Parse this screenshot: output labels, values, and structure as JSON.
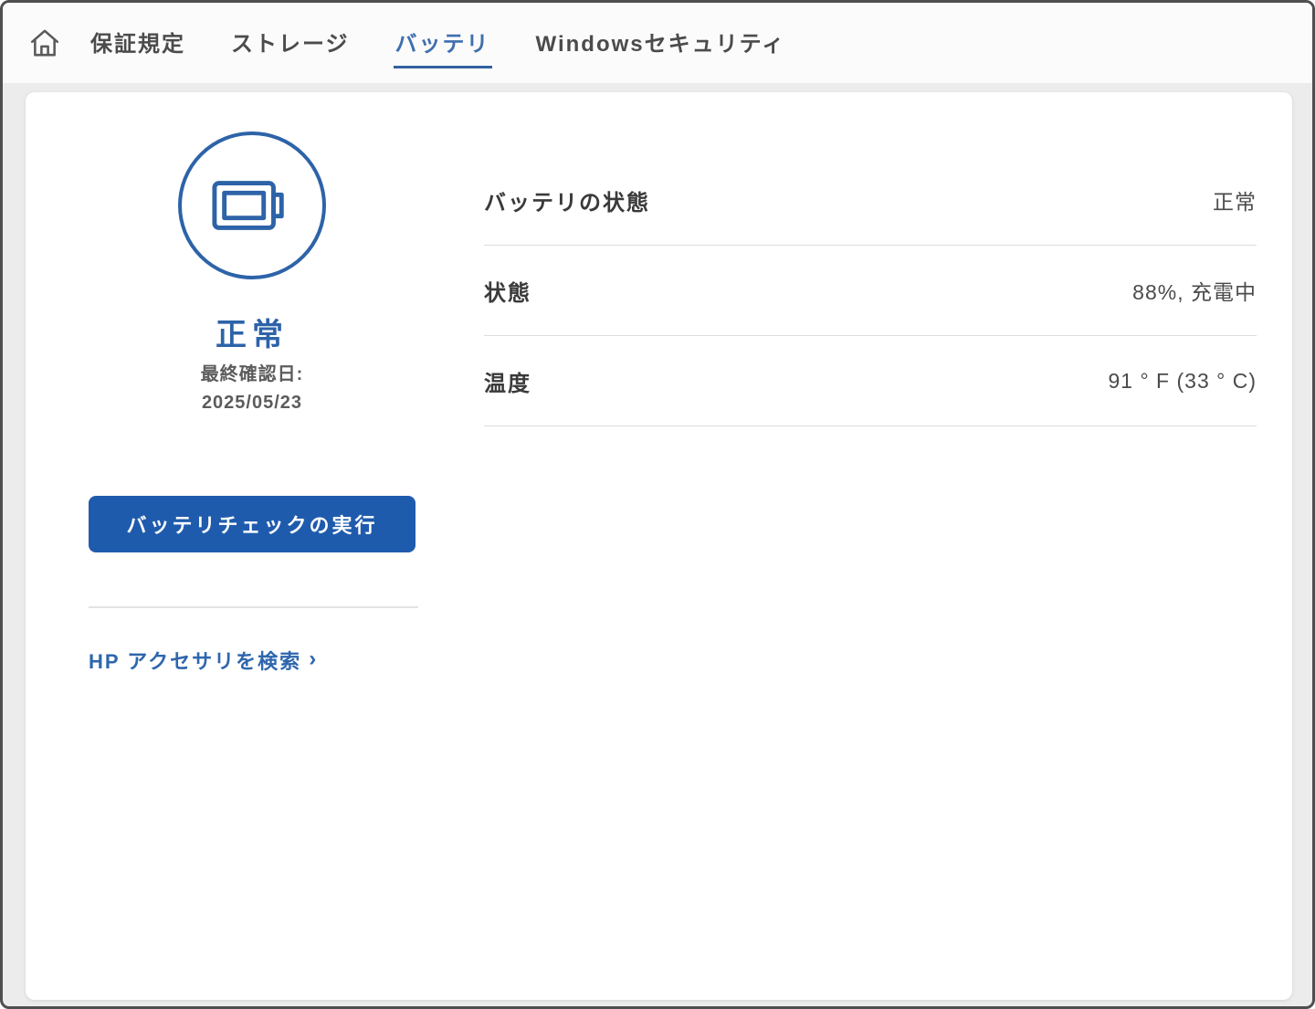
{
  "colors": {
    "accent": "#2d63a8",
    "button_bg": "#1f5bad",
    "active_tab": "#3f6fae",
    "frame_border": "#4f4f4f",
    "page_bg": "#ececec"
  },
  "nav": {
    "tabs": [
      {
        "label": "保証規定",
        "active": false
      },
      {
        "label": "ストレージ",
        "active": false
      },
      {
        "label": "バッテリ",
        "active": true
      },
      {
        "label": "Windowsセキュリティ",
        "active": false
      }
    ]
  },
  "battery_panel": {
    "status_text": "正常",
    "last_checked_label": "最終確認日:",
    "last_checked_date": "2025/05/23",
    "run_check_button": "バッテリチェックの実行",
    "accessories_link": "HP アクセサリを検索",
    "accessories_chevron": "›",
    "details": [
      {
        "label": "バッテリの状態",
        "value": "正常"
      },
      {
        "label": "状態",
        "value": "88%, 充電中"
      },
      {
        "label": "温度",
        "value": "91 ° F (33 ° C)"
      }
    ]
  }
}
